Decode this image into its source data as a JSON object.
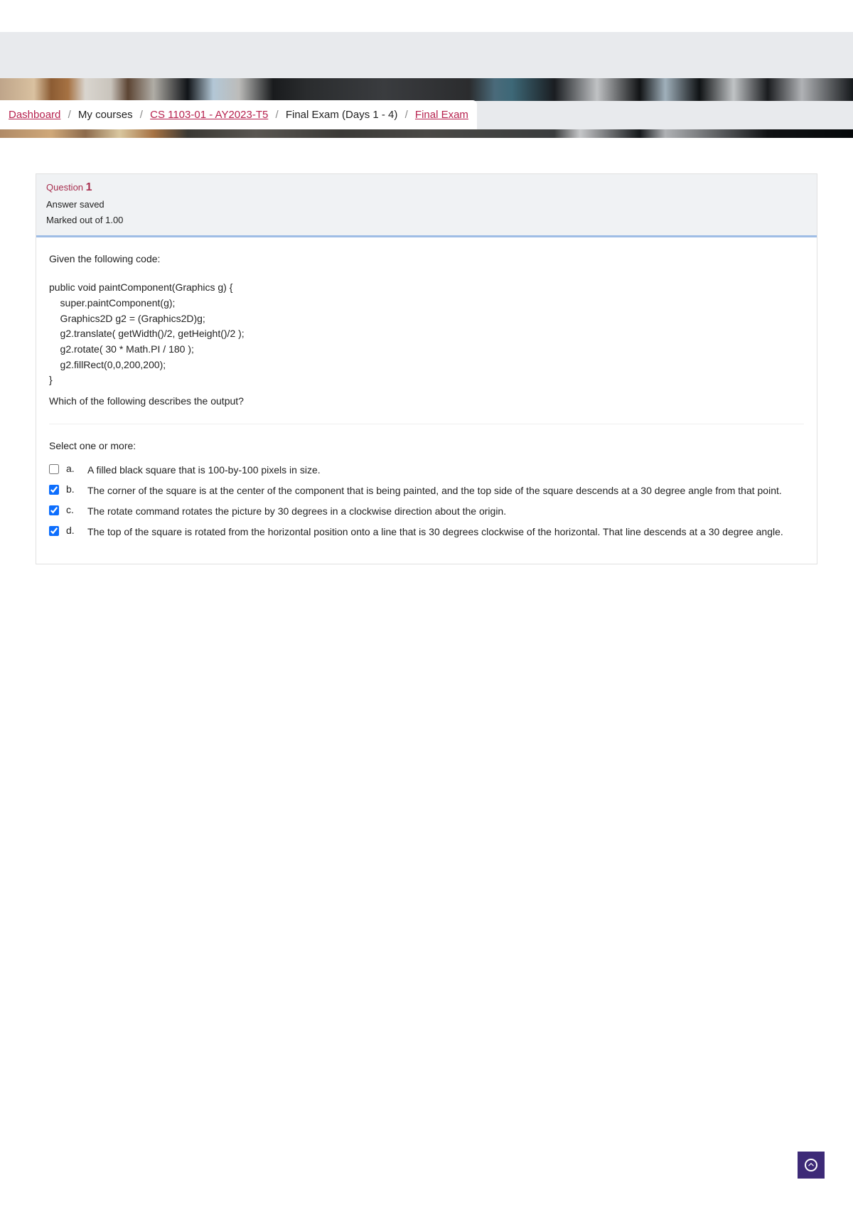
{
  "breadcrumb": {
    "dashboard": "Dashboard",
    "my_courses": "My courses",
    "course": "CS 1103-01 - AY2023-T5",
    "section": "Final Exam (Days 1 - 4)",
    "page": "Final Exam"
  },
  "question": {
    "label": "Question",
    "number": "1",
    "status": "Answer saved",
    "marked": "Marked out of 1.00",
    "intro": "Given the following code:",
    "code": "public void paintComponent(Graphics g) {\n    super.paintComponent(g);\n    Graphics2D g2 = (Graphics2D)g;\n    g2.translate( getWidth()/2, getHeight()/2 );\n    g2.rotate( 30 * Math.PI / 180 );\n    g2.fillRect(0,0,200,200);\n}",
    "followup": "Which of the following describes the output?",
    "select_label": "Select one or more:",
    "options": [
      {
        "letter": "a.",
        "text": "A filled black square that is 100-by-100 pixels in size.",
        "checked": false
      },
      {
        "letter": "b.",
        "text": "The corner of the square is at the center of the component that is being painted, and the top side of the square descends at a 30 degree angle from that point.",
        "checked": true
      },
      {
        "letter": "c.",
        "text": "The rotate command rotates the picture by 30 degrees in a clockwise direction about the origin.",
        "checked": true
      },
      {
        "letter": "d.",
        "text": "The top of the square is rotated from the horizontal position onto a line that is 30 degrees clockwise of the horizontal. That line descends at a 30 degree angle.",
        "checked": true
      }
    ]
  }
}
